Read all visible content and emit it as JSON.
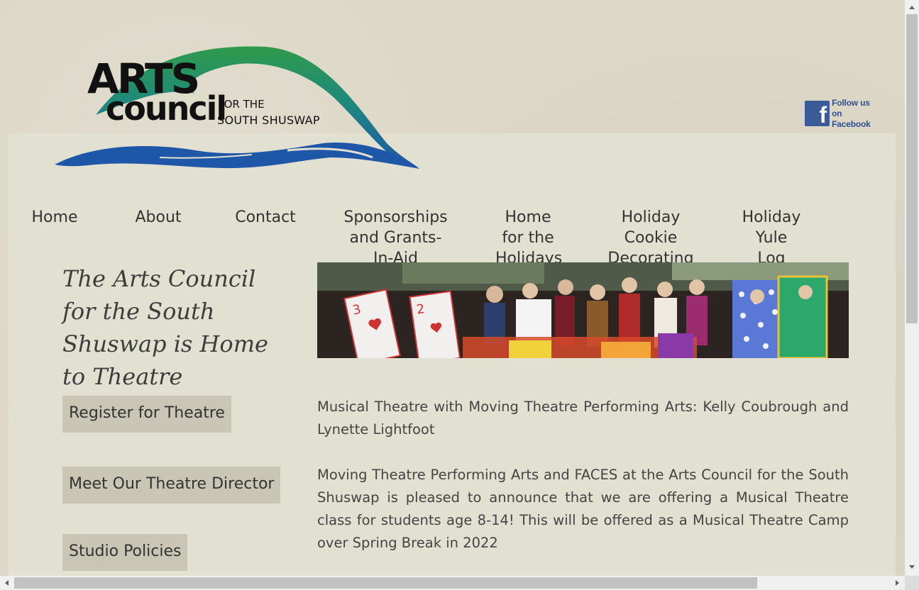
{
  "logo": {
    "word1": "ARTS",
    "word2": "council",
    "sub1": "FOR THE",
    "sub2": "SOUTH SHUSWAP"
  },
  "facebook": {
    "line1": "Follow us",
    "line2": "on Facebook"
  },
  "nav": {
    "items": [
      {
        "label": "Home"
      },
      {
        "label": "About"
      },
      {
        "label": "Contact"
      },
      {
        "label": "Sponsorships and Grants-In-Aid"
      },
      {
        "label": "Home for the Holidays"
      },
      {
        "label": "Holiday Cookie Decorating"
      },
      {
        "label": "Holiday Yule Log"
      }
    ]
  },
  "heading": "The Arts Council for the South Shuswap is Home to Theatre",
  "buttons": {
    "register": "Register for Theatre",
    "director": "Meet Our Theatre Director",
    "policies": "Studio Policies"
  },
  "content": {
    "para1": "Musical Theatre with Moving Theatre Performing Arts: Kelly Coubrough and Lynette Lightfoot",
    "para2": "Moving Theatre Performing Arts and FACES at the Arts Council for the South Shuswap is pleased to announce that we are offering a Musical Theatre class for students age 8-14! This will be offered as a Musical Theatre Camp over Spring Break in 2022"
  },
  "colors": {
    "logo_green": "#2f9a4a",
    "logo_blue": "#1e56a8",
    "facebook_blue": "#3b5b98",
    "button_bg": "#c9c6b5",
    "panel_bg": "#e2e0d1"
  }
}
